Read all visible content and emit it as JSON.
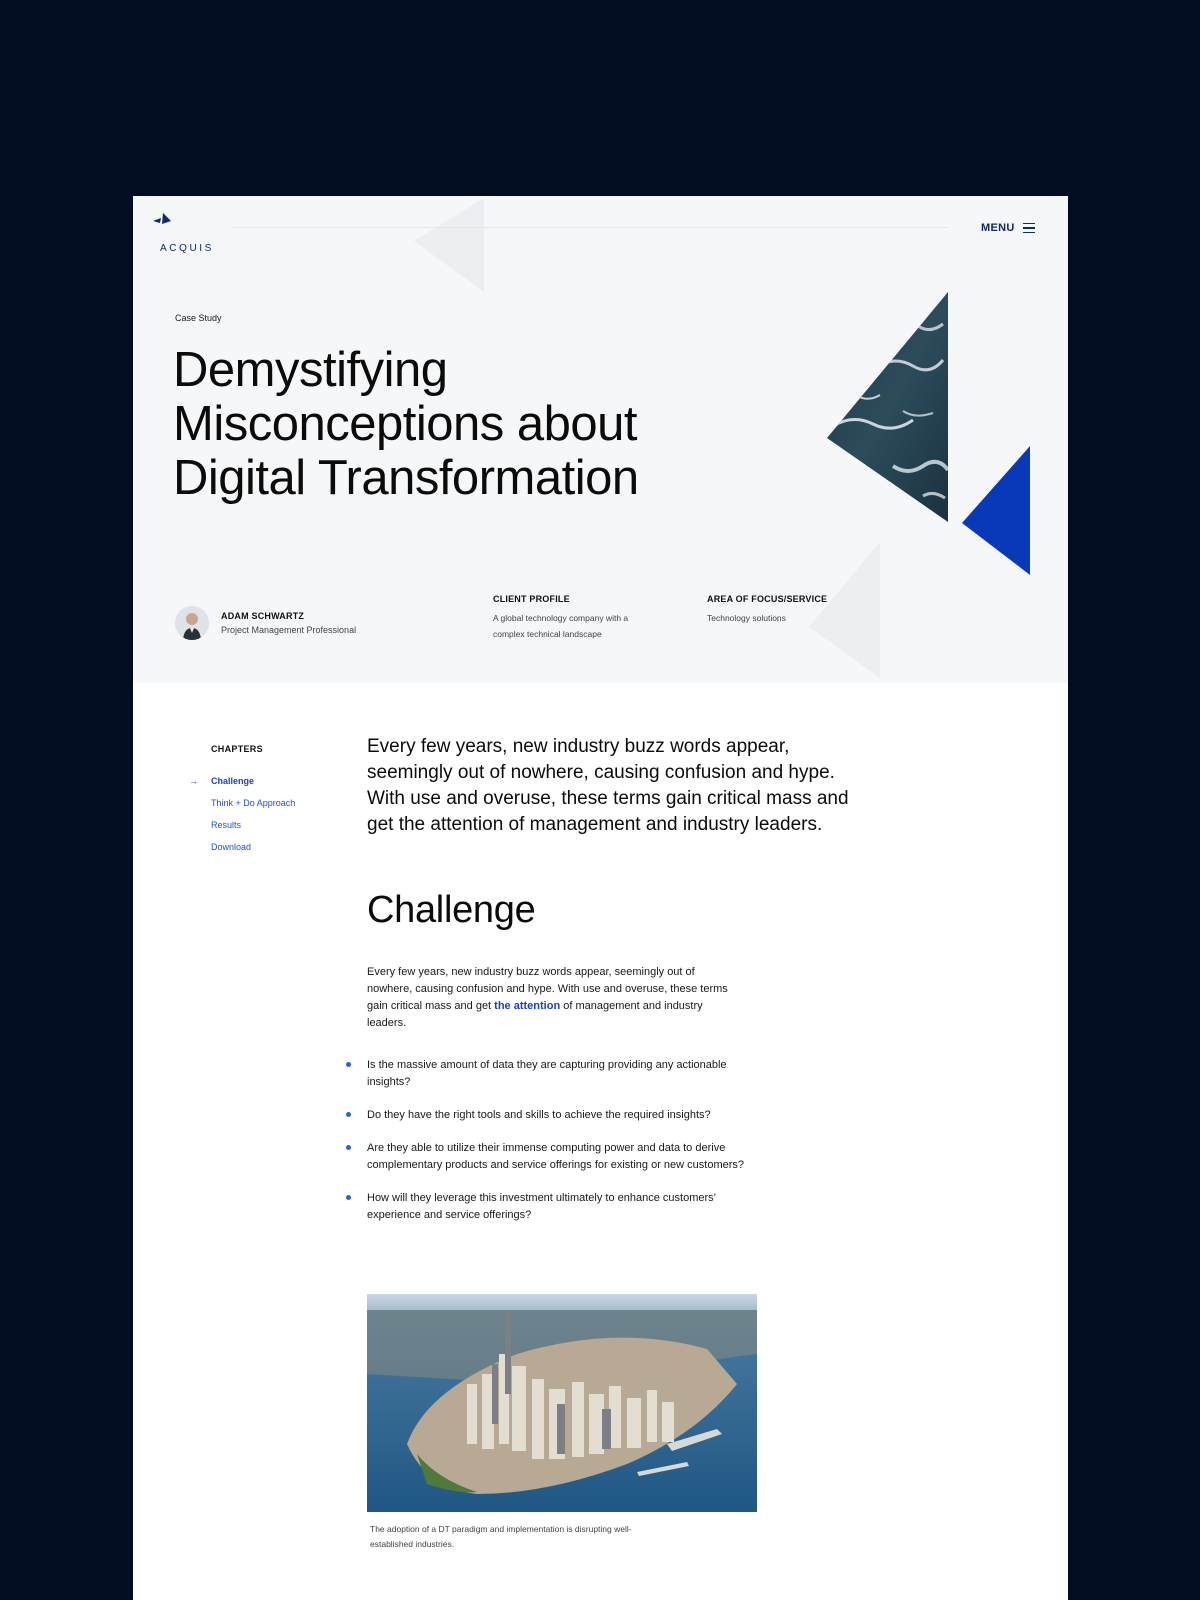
{
  "brand": {
    "name": "ACQUIS",
    "color": "#0d2a70"
  },
  "nav": {
    "menu_label": "MENU",
    "menu_icon": "hamburger-icon"
  },
  "hero": {
    "eyebrow": "Case Study",
    "title": "Demystifying\nMisconceptions about\nDigital Transformation"
  },
  "author": {
    "name": "ADAM SCHWARTZ",
    "role": "Project Management Professional"
  },
  "client_profile": {
    "heading": "CLIENT PROFILE",
    "text": "A global technology company with a complex technical landscape"
  },
  "focus": {
    "heading": "AREA OF FOCUS/SERVICE",
    "text": "Technology solutions"
  },
  "chapters": {
    "heading": "CHAPTERS",
    "active_marker": "→",
    "items": [
      {
        "label": "Challenge",
        "active": true
      },
      {
        "label": "Think + Do Approach"
      },
      {
        "label": "Results"
      },
      {
        "label": "Download"
      }
    ]
  },
  "lead": "Every few years, new industry buzz words appear, seemingly out of nowhere, causing confusion and hype. With use and overuse, these terms gain critical mass and get the attention of management and industry leaders.",
  "challenge": {
    "title": "Challenge",
    "para_before": "Every few years, new industry buzz words appear, seemingly out of nowhere, causing confusion and hype. With use and overuse, these terms gain critical mass and get ",
    "para_highlight": "the attention",
    "para_after": " of management and industry leaders.",
    "bullets": [
      "Is the massive amount of data they are capturing providing any actionable insights?",
      "Do they have the right tools and skills to achieve the required insights?",
      "Are they able to utilize their immense computing power and data to derive complementary products and service offerings for existing or new customers?",
      "How will they leverage this investment ultimately to enhance customers’ experience and service offerings?"
    ],
    "image_caption": "The adoption of a DT paradigm and implementation is disrupting well-established industries."
  },
  "colors": {
    "page_bg": "#020c22",
    "hero_bg": "#f5f7f9",
    "accent_blue": "#0a39b8",
    "link_blue": "#1f4fe0"
  }
}
